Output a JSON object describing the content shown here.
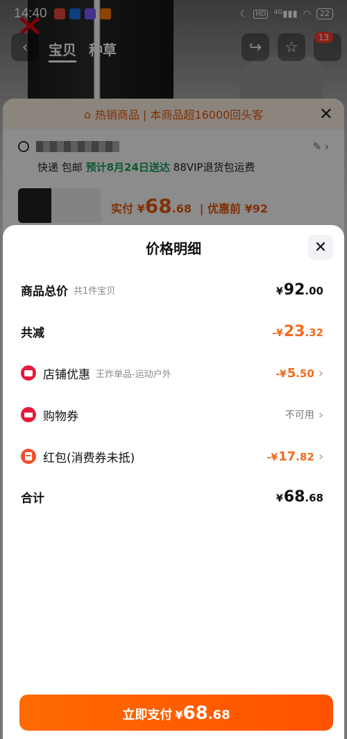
{
  "status_bar": {
    "time": "14:40",
    "network": "4G",
    "hd_label": "HD",
    "battery": "22"
  },
  "background_page": {
    "tabs": [
      {
        "label": "宝贝",
        "active": true
      },
      {
        "label": "种草",
        "active": false
      }
    ],
    "cart_count": "13",
    "hot_banner": "热销商品 | 本商品超16000回头客",
    "shipping_prefix": "快递 包邮",
    "shipping_estimate": "预计8月24日送达",
    "return_policy": "88VIP退货包运费",
    "paid_label": "实付",
    "paid_currency": "¥",
    "paid_int": "68",
    "paid_dec": ".68",
    "before_discount": "优惠前 ¥92"
  },
  "price_detail": {
    "title": "价格明细",
    "rows": {
      "total": {
        "label": "商品总价",
        "sub": "共1件宝贝",
        "currency": "¥",
        "int": "92",
        "dec": ".00"
      },
      "reduced": {
        "label": "共减",
        "currency": "-¥",
        "int": "23",
        "dec": ".32"
      },
      "shop_discount": {
        "label": "店铺优惠",
        "sub": "王炸单品-运动户外",
        "currency": "-¥",
        "int": "5",
        "dec": ".50"
      },
      "coupon": {
        "label": "购物券",
        "status": "不可用"
      },
      "red_packet": {
        "label": "红包(消费券未抵)",
        "currency": "-¥",
        "int": "17",
        "dec": ".82"
      },
      "subtotal": {
        "label": "合计",
        "currency": "¥",
        "int": "68",
        "dec": ".68"
      }
    },
    "pay_button": {
      "label": "立即支付",
      "currency": "¥",
      "int": "68",
      "dec": ".68"
    }
  },
  "colors": {
    "accent_orange": "#ff6a00",
    "discount_orange": "#f26b1d",
    "shop_red": "#e8193c",
    "green_estimate": "#1a9e5c"
  }
}
